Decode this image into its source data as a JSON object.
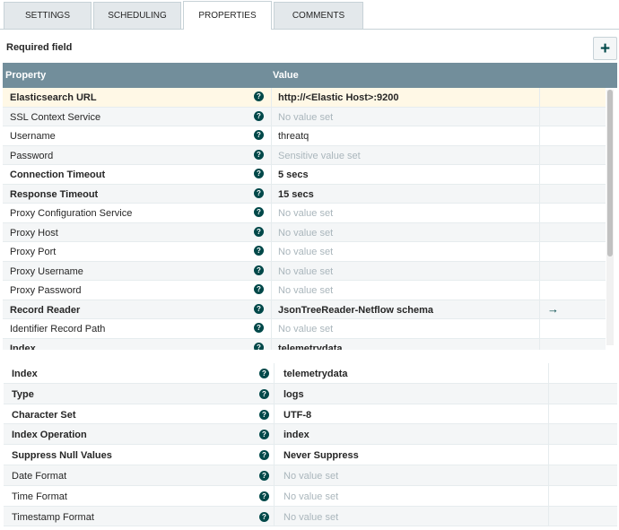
{
  "tabs": [
    {
      "label": "SETTINGS",
      "active": false
    },
    {
      "label": "SCHEDULING",
      "active": false
    },
    {
      "label": "PROPERTIES",
      "active": true
    },
    {
      "label": "COMMENTS",
      "active": false
    }
  ],
  "required_label": "Required field",
  "add_button_glyph": "+",
  "table_header": {
    "property": "Property",
    "value": "Value"
  },
  "help_glyph": "?",
  "properties": [
    {
      "name": "Elasticsearch URL",
      "value": "http://<Elastic Host>:9200",
      "required": true,
      "placeholder": false,
      "link": false
    },
    {
      "name": "SSL Context Service",
      "value": "No value set",
      "required": false,
      "placeholder": true,
      "link": false
    },
    {
      "name": "Username",
      "value": "threatq",
      "required": false,
      "placeholder": false,
      "link": false
    },
    {
      "name": "Password",
      "value": "Sensitive value set",
      "required": false,
      "placeholder": true,
      "link": false
    },
    {
      "name": "Connection Timeout",
      "value": "5 secs",
      "required": true,
      "placeholder": false,
      "link": false
    },
    {
      "name": "Response Timeout",
      "value": "15 secs",
      "required": true,
      "placeholder": false,
      "link": false
    },
    {
      "name": "Proxy Configuration Service",
      "value": "No value set",
      "required": false,
      "placeholder": true,
      "link": false
    },
    {
      "name": "Proxy Host",
      "value": "No value set",
      "required": false,
      "placeholder": true,
      "link": false
    },
    {
      "name": "Proxy Port",
      "value": "No value set",
      "required": false,
      "placeholder": true,
      "link": false
    },
    {
      "name": "Proxy Username",
      "value": "No value set",
      "required": false,
      "placeholder": true,
      "link": false
    },
    {
      "name": "Proxy Password",
      "value": "No value set",
      "required": false,
      "placeholder": true,
      "link": false
    },
    {
      "name": "Record Reader",
      "value": "JsonTreeReader-Netflow schema",
      "required": true,
      "placeholder": false,
      "link": true
    },
    {
      "name": "Identifier Record Path",
      "value": "No value set",
      "required": false,
      "placeholder": true,
      "link": false
    },
    {
      "name": "Index",
      "value": "telemetrydata",
      "required": true,
      "placeholder": false,
      "link": false
    }
  ],
  "arrow_glyph": "→",
  "properties_continued": [
    {
      "name": "Index",
      "value": "telemetrydata",
      "required": true,
      "placeholder": false
    },
    {
      "name": "Type",
      "value": "logs",
      "required": true,
      "placeholder": false
    },
    {
      "name": "Character Set",
      "value": "UTF-8",
      "required": true,
      "placeholder": false
    },
    {
      "name": "Index Operation",
      "value": "index",
      "required": true,
      "placeholder": false
    },
    {
      "name": "Suppress Null Values",
      "value": "Never Suppress",
      "required": true,
      "placeholder": false
    },
    {
      "name": "Date Format",
      "value": "No value set",
      "required": false,
      "placeholder": true
    },
    {
      "name": "Time Format",
      "value": "No value set",
      "required": false,
      "placeholder": true
    },
    {
      "name": "Timestamp Format",
      "value": "No value set",
      "required": false,
      "placeholder": true
    }
  ],
  "colors": {
    "header": "#728e9b",
    "accent": "#004849",
    "selected_row": "#fff8e6",
    "alt_row": "#f4f6f7"
  }
}
